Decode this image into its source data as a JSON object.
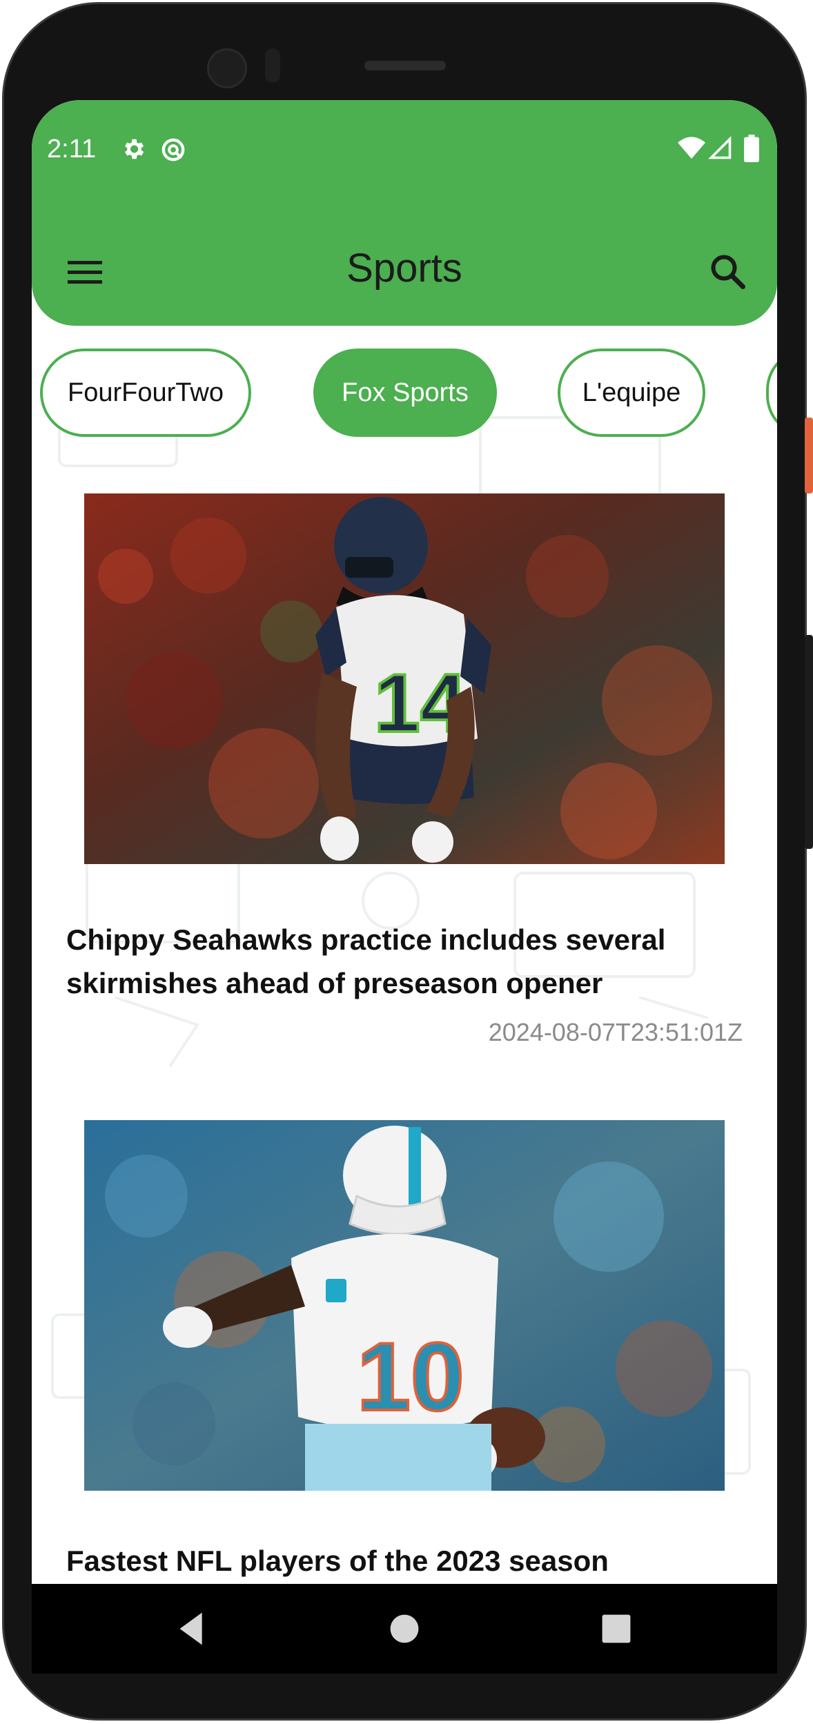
{
  "status_bar": {
    "time": "2:11",
    "icons": [
      "settings-icon",
      "data-saver-icon",
      "wifi-icon",
      "signal-icon",
      "battery-icon"
    ]
  },
  "app_bar": {
    "title": "Sports",
    "menu_icon": "hamburger-menu-icon",
    "search_icon": "search-icon",
    "color": "#4caf50"
  },
  "sources": [
    {
      "label": "FourFourTwo",
      "active": false
    },
    {
      "label": "Fox Sports",
      "active": true
    },
    {
      "label": "L'equipe",
      "active": false
    }
  ],
  "articles": [
    {
      "title": "Chippy Seahawks practice includes several skirmishes ahead of preseason opener",
      "date": "2024-08-07T23:51:01Z",
      "image": "seahawks-player-14-photo"
    },
    {
      "title": "Fastest NFL players of the 2023 season",
      "date": "",
      "image": "dolphins-player-10-photo"
    }
  ],
  "nav_bar": {
    "buttons": [
      "back-icon",
      "home-icon",
      "recents-icon"
    ]
  }
}
